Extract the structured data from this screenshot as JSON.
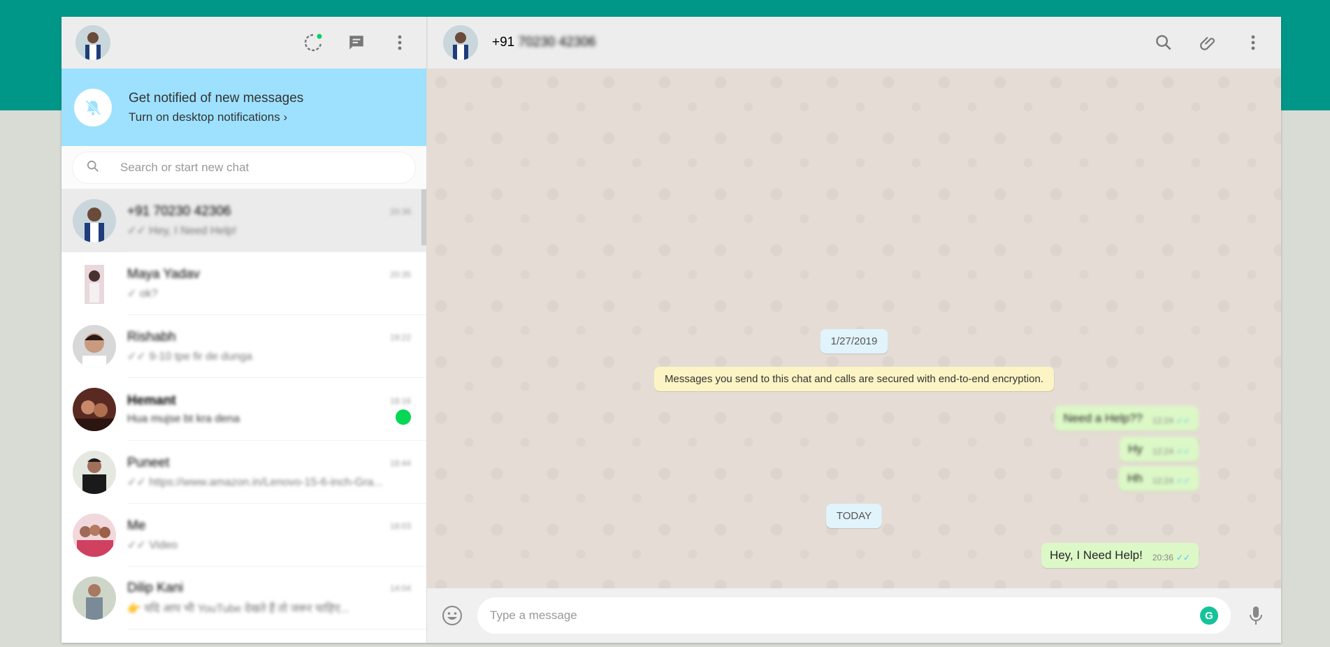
{
  "sidebar": {
    "header_icons": [
      "status-icon",
      "new-chat-icon",
      "menu-icon"
    ],
    "notification": {
      "title": "Get notified of new messages",
      "subtitle": "Turn on desktop notifications ›"
    },
    "search_placeholder": "Search or start new chat",
    "chats": [
      {
        "name": "+91 70230 42306",
        "time": "20:36",
        "preview": "✓✓ Hey, I Need Help!",
        "active": true
      },
      {
        "name": "Maya Yadav",
        "time": "20:35",
        "preview": "✓ ok?"
      },
      {
        "name": "Rishabh",
        "time": "19:22",
        "preview": "✓✓ 9-10 tpe fir de dunga"
      },
      {
        "name": "Hemant",
        "time": "18:16",
        "preview": "Hua mujse bt kra dena",
        "unread": true
      },
      {
        "name": "Puneet",
        "time": "18:44",
        "preview": "✓✓ https://www.amazon.in/Lenovo-15-6-inch-Gra..."
      },
      {
        "name": "Me",
        "time": "18:03",
        "preview": "✓✓ Video"
      },
      {
        "name": "Dilip Kani",
        "time": "14:04",
        "preview": "👉 यदि आप भी YouTube देखते हैं तो जरूर चाहिए..."
      }
    ]
  },
  "conversation": {
    "contact_prefix": "+91",
    "contact_number": "70230 42306",
    "date_old": "1/27/2019",
    "encryption_notice": "Messages you send to this chat and calls are secured with end-to-end encryption.",
    "old_messages": [
      {
        "text": "Need a Help??",
        "time": "12:24"
      },
      {
        "text": "Hy",
        "time": "12:24"
      },
      {
        "text": "Hh",
        "time": "12:24"
      }
    ],
    "date_today": "TODAY",
    "last_message": {
      "text": "Hey, I Need Help!",
      "time": "20:36"
    },
    "composer_placeholder": "Type a message",
    "grammarly_glyph": "G"
  },
  "colors": {
    "accent": "#009688",
    "notify_bg": "#9de1fe",
    "outgoing": "#dcf8c6",
    "ticks": "#4fc3f7"
  }
}
